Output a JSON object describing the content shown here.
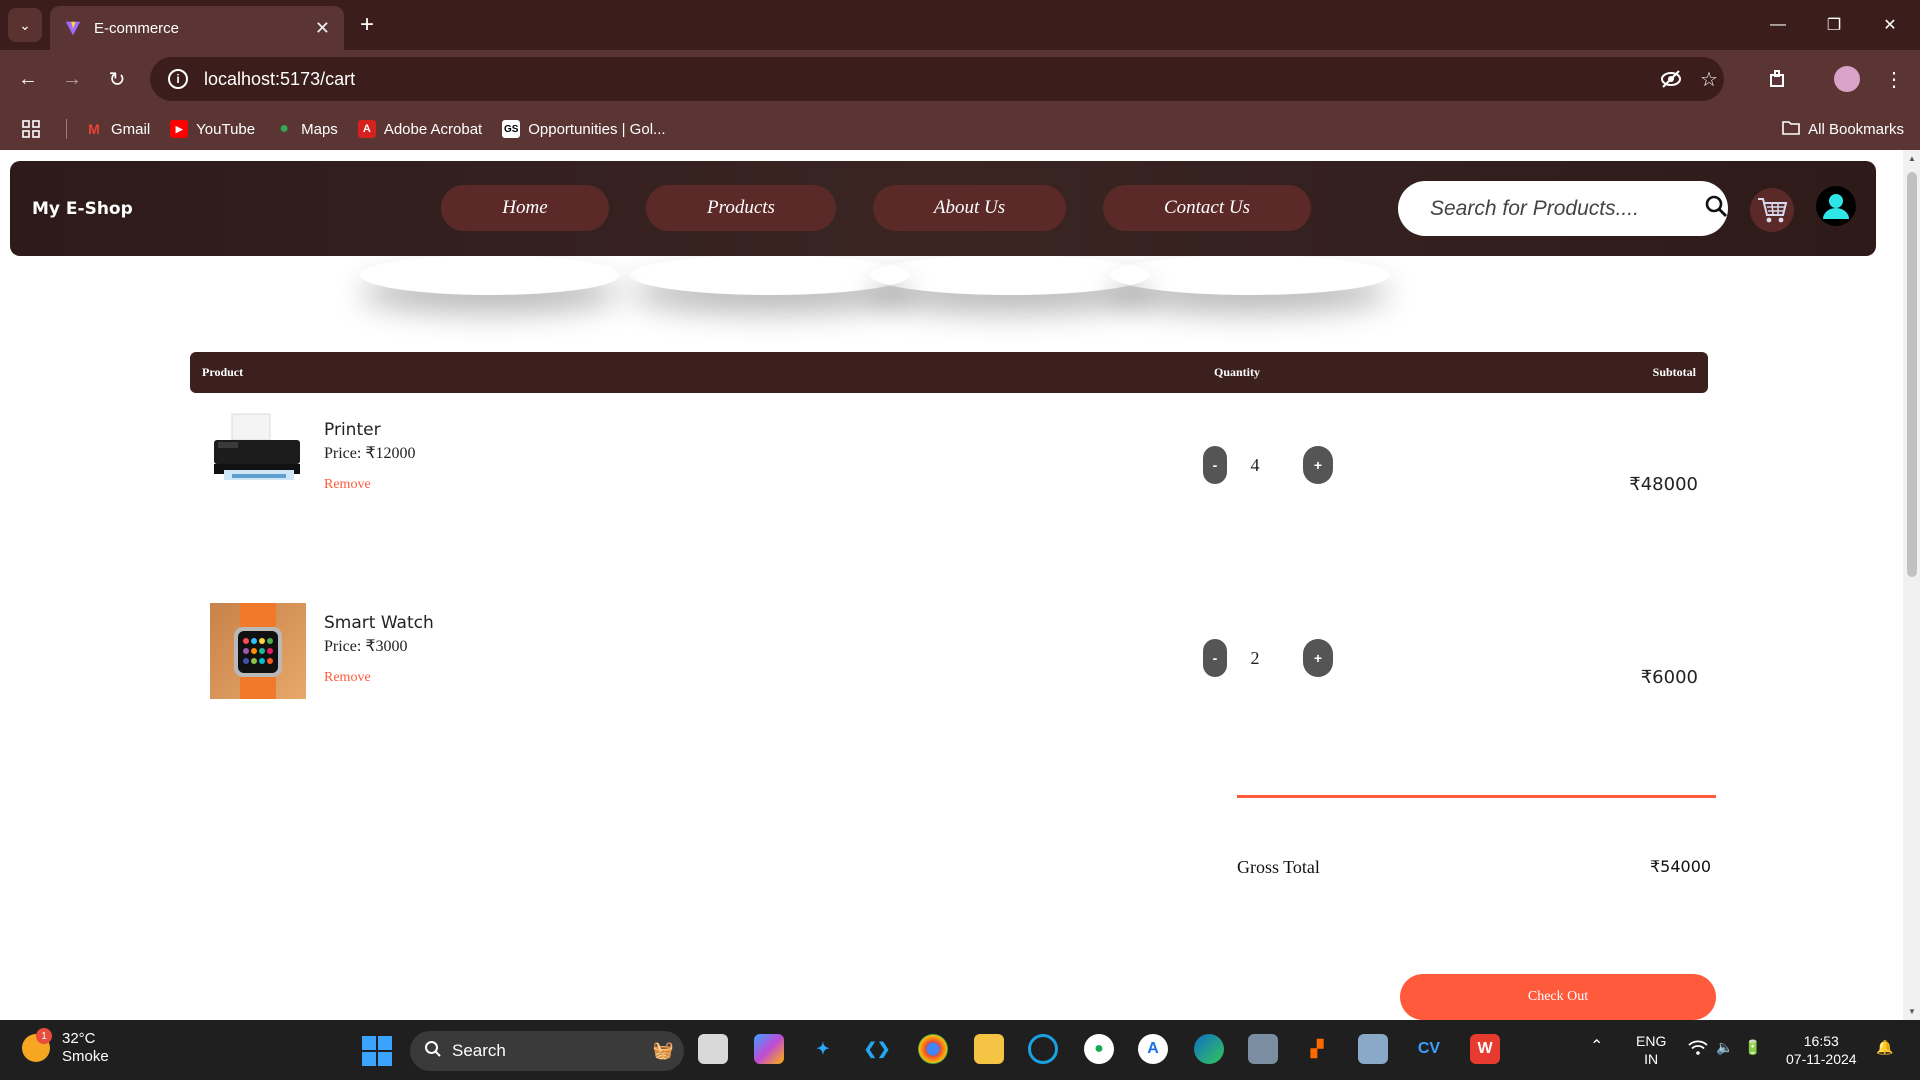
{
  "browser": {
    "tab_title": "E-commerce",
    "url": "localhost:5173/cart",
    "bookmarks": [
      {
        "label": "Gmail",
        "icon": "gmail-icon"
      },
      {
        "label": "YouTube",
        "icon": "youtube-icon"
      },
      {
        "label": "Maps",
        "icon": "maps-icon"
      },
      {
        "label": "Adobe Acrobat",
        "icon": "acrobat-icon"
      },
      {
        "label": "Opportunities | Gol...",
        "icon": "gs-icon"
      }
    ],
    "all_bookmarks": "All Bookmarks"
  },
  "header": {
    "brand": "My E-Shop",
    "nav": [
      "Home",
      "Products",
      "About Us",
      "Contact Us"
    ],
    "search_placeholder": "Search for Products...."
  },
  "cart": {
    "columns": {
      "product": "Product",
      "quantity": "Quantity",
      "subtotal": "Subtotal"
    },
    "items": [
      {
        "name": "Printer",
        "price": "Price: ₹12000",
        "remove": "Remove",
        "qty": "4",
        "subtotal": "₹48000",
        "image": "printer-image"
      },
      {
        "name": "Smart Watch",
        "price": "Price: ₹3000",
        "remove": "Remove",
        "qty": "2",
        "subtotal": "₹6000",
        "image": "smartwatch-image"
      }
    ],
    "minus": "-",
    "plus": "+",
    "gross_label": "Gross Total",
    "gross_value": "₹54000",
    "checkout": "Check Out"
  },
  "taskbar": {
    "temperature": "32°C",
    "weather": "Smoke",
    "weather_badge": "1",
    "search": "Search",
    "lang1": "ENG",
    "lang2": "IN",
    "time": "16:53",
    "date": "07-11-2024"
  },
  "colors": {
    "accent": "#ff5a3c",
    "header_bg": "#2d1a19",
    "nav_pill": "#5b2a28",
    "table_head": "#3b201e"
  }
}
